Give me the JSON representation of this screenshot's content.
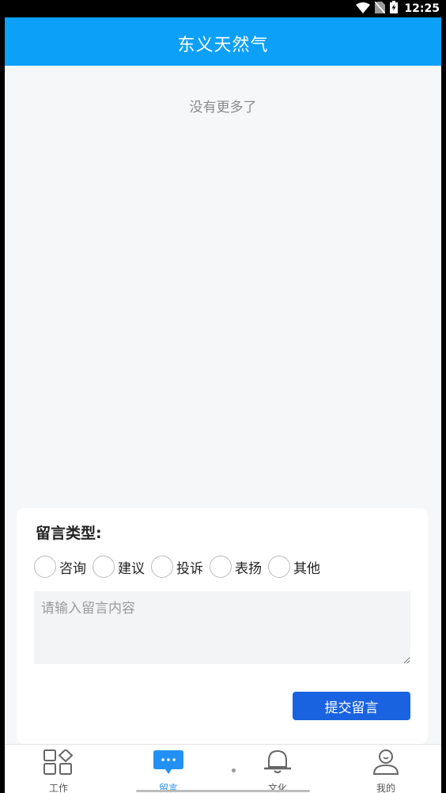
{
  "status_bar": {
    "time": "12:25",
    "icons": [
      "wifi-icon",
      "no-sim-icon",
      "battery-charging-icon"
    ]
  },
  "header": {
    "title": "东义天然气"
  },
  "list": {
    "empty_text": "没有更多了"
  },
  "form": {
    "type_label": "留言类型:",
    "options": [
      {
        "label": "咨询"
      },
      {
        "label": "建议"
      },
      {
        "label": "投诉"
      },
      {
        "label": "表扬"
      },
      {
        "label": "其他"
      }
    ],
    "content": {
      "value": "",
      "placeholder": "请输入留言内容"
    },
    "submit_label": "提交留言"
  },
  "tabbar": {
    "items": [
      {
        "label": "工作",
        "icon": "grid-icon"
      },
      {
        "label": "留言",
        "icon": "message-icon",
        "active": true
      },
      {
        "label": "文化",
        "icon": "bell-icon"
      },
      {
        "label": "我的",
        "icon": "user-icon"
      }
    ]
  },
  "colors": {
    "header": "#0ca0f8",
    "accent": "#1a63e0",
    "active_tab": "#1a8af2"
  }
}
